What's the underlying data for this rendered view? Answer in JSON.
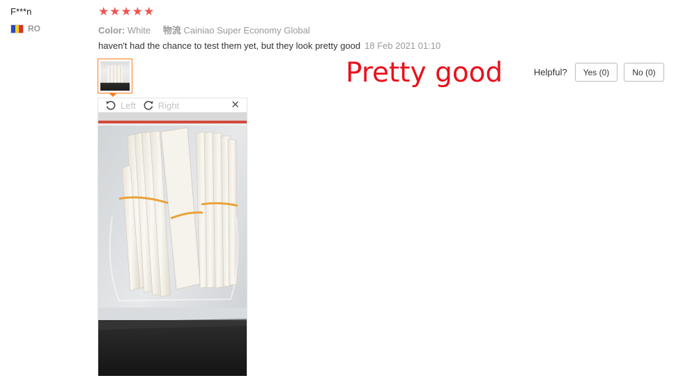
{
  "user": {
    "name": "F***n",
    "country": "RO",
    "flag_colors": [
      "#2b4bb4",
      "#f4d21a",
      "#d9302c"
    ]
  },
  "rating": {
    "stars": 5,
    "max": 5,
    "star_glyph": "★",
    "color": "#f05450"
  },
  "order": {
    "color_label": "Color:",
    "color_value": "White",
    "shipping_label": "物流",
    "shipping_value": "Cainiao Super Economy Global"
  },
  "review": {
    "text": "haven't had the chance to test them yet, but they look pretty good",
    "date": "18 Feb 2021 01:10"
  },
  "overlay_caption": "Pretty good",
  "helpful": {
    "label": "Helpful?",
    "yes_label": "Yes (0)",
    "no_label": "No (0)"
  },
  "viewer": {
    "rotate_left_label": "Left",
    "rotate_right_label": "Right",
    "close_glyph": "✕",
    "icons": [
      "rotate-left-icon",
      "rotate-right-icon",
      "close-icon"
    ]
  }
}
